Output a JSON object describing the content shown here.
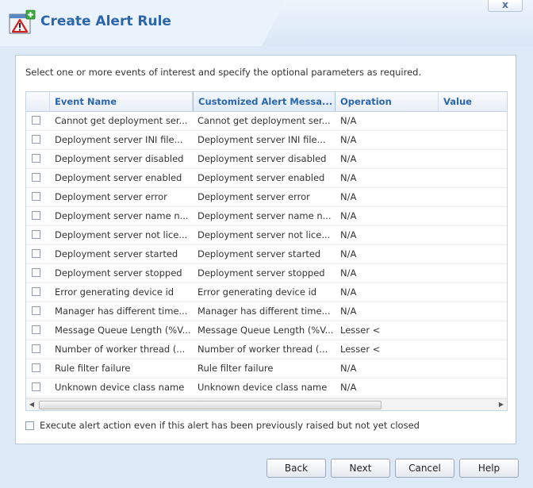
{
  "window": {
    "title": "Create Alert Rule",
    "close_label": "x"
  },
  "instruction": "Select one or more events of interest and specify the optional parameters as required.",
  "table": {
    "columns": [
      "Event Name",
      "Customized Alert Messa...",
      "Operation",
      "Value"
    ],
    "rows": [
      {
        "event": "Cannot get deployment ser...",
        "message": "Cannot get deployment ser...",
        "operation": "N/A",
        "value": ""
      },
      {
        "event": "Deployment server INI file...",
        "message": "Deployment server INI file...",
        "operation": "N/A",
        "value": ""
      },
      {
        "event": "Deployment server disabled",
        "message": "Deployment server disabled",
        "operation": "N/A",
        "value": ""
      },
      {
        "event": "Deployment server enabled",
        "message": "Deployment server enabled",
        "operation": "N/A",
        "value": ""
      },
      {
        "event": "Deployment server error",
        "message": "Deployment server error",
        "operation": "N/A",
        "value": ""
      },
      {
        "event": "Deployment server name n...",
        "message": "Deployment server name n...",
        "operation": "N/A",
        "value": ""
      },
      {
        "event": "Deployment server not lice...",
        "message": "Deployment server not lice...",
        "operation": "N/A",
        "value": ""
      },
      {
        "event": "Deployment server started",
        "message": "Deployment server started",
        "operation": "N/A",
        "value": ""
      },
      {
        "event": "Deployment server stopped",
        "message": "Deployment server stopped",
        "operation": "N/A",
        "value": ""
      },
      {
        "event": "Error generating device id",
        "message": "Error generating device id",
        "operation": "N/A",
        "value": ""
      },
      {
        "event": "Manager has different time...",
        "message": "Manager has different time...",
        "operation": "N/A",
        "value": ""
      },
      {
        "event": "Message Queue Length (%V...",
        "message": "Message Queue Length (%V...",
        "operation": "Lesser <",
        "value": ""
      },
      {
        "event": "Number of worker thread (...",
        "message": "Number of worker thread (...",
        "operation": "Lesser <",
        "value": ""
      },
      {
        "event": "Rule filter failure",
        "message": "Rule filter failure",
        "operation": "N/A",
        "value": ""
      },
      {
        "event": "Unknown device class name",
        "message": "Unknown device class name",
        "operation": "N/A",
        "value": ""
      }
    ]
  },
  "option": {
    "label": "Execute alert action even if this alert has been previously raised but not yet closed"
  },
  "buttons": {
    "back": "Back",
    "next": "Next",
    "cancel": "Cancel",
    "help": "Help"
  },
  "icons": {
    "app": "alert-rule-add-icon",
    "scroll_left": "arrow-left-icon",
    "scroll_right": "arrow-right-icon"
  },
  "colors": {
    "title": "#2b66ad",
    "background": "#dde9f6"
  }
}
